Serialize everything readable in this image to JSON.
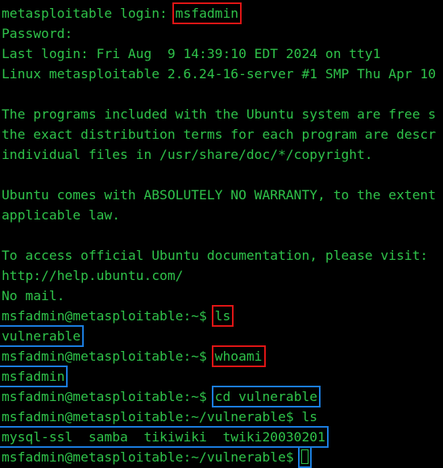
{
  "terminal": {
    "login_prompt": "metasploitable login: ",
    "login_user": "msfadmin",
    "password_prompt": "Password:",
    "last_login": "Last login: Fri Aug  9 14:39:10 EDT 2024 on tty1",
    "kernel": "Linux metasploitable 2.6.24-16-server #1 SMP Thu Apr 10",
    "motd1": "The programs included with the Ubuntu system are free s",
    "motd2": "the exact distribution terms for each program are descr",
    "motd3": "individual files in /usr/share/doc/*/copyright.",
    "motd4": "Ubuntu comes with ABSOLUTELY NO WARRANTY, to the extent",
    "motd5": "applicable law.",
    "motd6": "To access official Ubuntu documentation, please visit:",
    "motd7": "http://help.ubuntu.com/",
    "no_mail": "No mail.",
    "prompt_home": "msfadmin@metasploitable:~$ ",
    "prompt_vuln": "msfadmin@metasploitable:~/vulnerable$ ",
    "cmd1": "ls",
    "out1": "vulnerable",
    "cmd2": "whoami",
    "out2": "msfadmin",
    "cmd3": "cd vulnerable",
    "cmd4": "ls",
    "out4": "mysql-ssl  samba  tikiwiki  twiki20030201"
  },
  "colors": {
    "text": "#2fc24a",
    "background": "#000000",
    "highlight_red": "#e01515",
    "highlight_blue": "#1b7de0"
  }
}
